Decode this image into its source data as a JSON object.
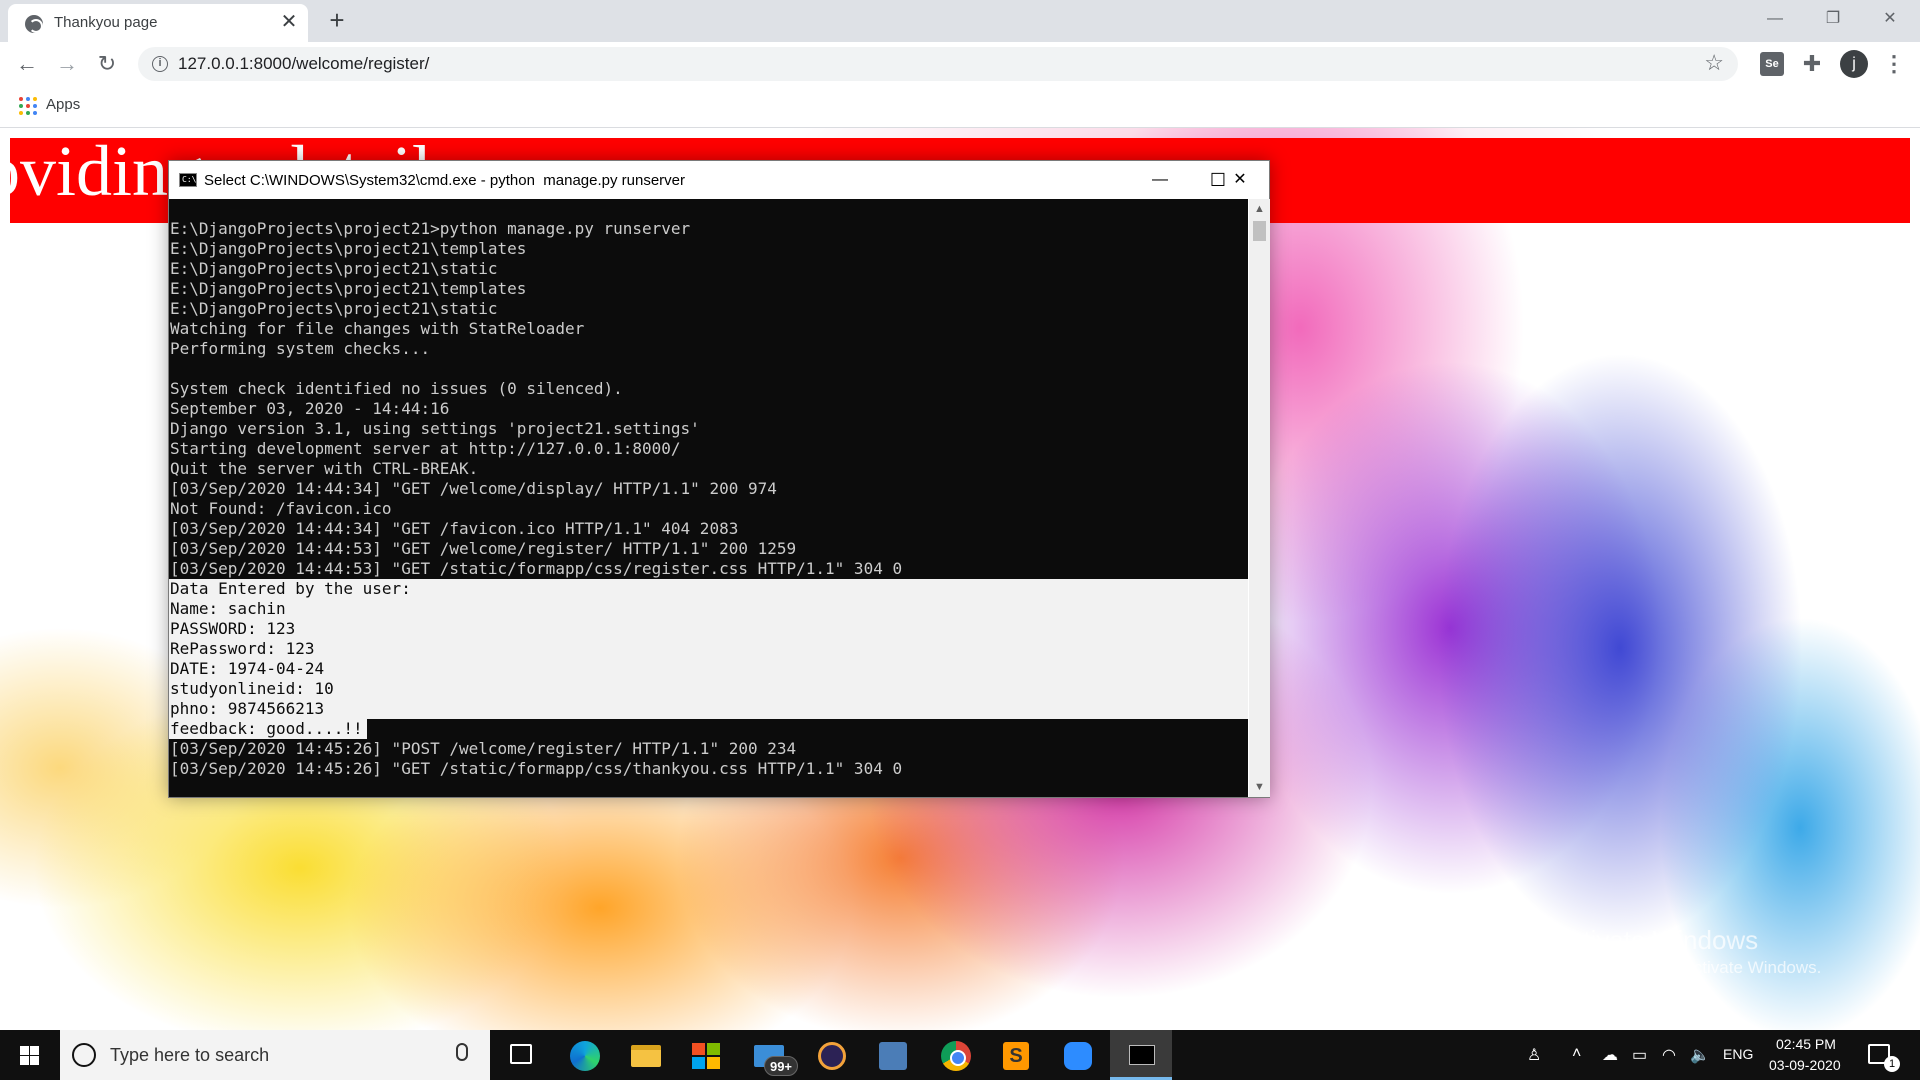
{
  "browser": {
    "tab_title": "Thankyou page",
    "tab_close": "✕",
    "new_tab": "+",
    "url": "127.0.0.1:8000/welcome/register/",
    "bookmarks_label": "Apps",
    "profile_initial": "j",
    "extension_label": "Se"
  },
  "page": {
    "header_text": "oviding e details",
    "header_color": "#ff0000",
    "watermark_title": "Activate Windows",
    "watermark_subtitle": "Go to Settings to activate Windows."
  },
  "cmd": {
    "title": "Select C:\\WINDOWS\\System32\\cmd.exe - python  manage.py runserver",
    "lines_normal": [
      "E:\\DjangoProjects\\project21>python manage.py runserver",
      "E:\\DjangoProjects\\project21\\templates",
      "E:\\DjangoProjects\\project21\\static",
      "E:\\DjangoProjects\\project21\\templates",
      "E:\\DjangoProjects\\project21\\static",
      "Watching for file changes with StatReloader",
      "Performing system checks...",
      "",
      "System check identified no issues (0 silenced).",
      "September 03, 2020 - 14:44:16",
      "Django version 3.1, using settings 'project21.settings'",
      "Starting development server at http://127.0.0.1:8000/",
      "Quit the server with CTRL-BREAK.",
      "[03/Sep/2020 14:44:34] \"GET /welcome/display/ HTTP/1.1\" 200 974",
      "Not Found: /favicon.ico",
      "[03/Sep/2020 14:44:34] \"GET /favicon.ico HTTP/1.1\" 404 2083",
      "[03/Sep/2020 14:44:53] \"GET /welcome/register/ HTTP/1.1\" 200 1259",
      "[03/Sep/2020 14:44:53] \"GET /static/formapp/css/register.css HTTP/1.1\" 304 0"
    ],
    "lines_selected": [
      "Data Entered by the user:",
      "Name: sachin",
      "PASSWORD: 123",
      "RePassword: 123",
      "DATE: 1974-04-24",
      "studyonlineid: 10",
      "phno: 9874566213",
      "feedback: good....!!"
    ],
    "lines_after": [
      "[03/Sep/2020 14:45:26] \"POST /welcome/register/ HTTP/1.1\" 200 234",
      "[03/Sep/2020 14:45:26] \"GET /static/formapp/css/thankyou.css HTTP/1.1\" 304 0"
    ]
  },
  "taskbar": {
    "search_placeholder": "Type here to search",
    "mail_badge": "99+",
    "language": "ENG",
    "time": "02:45 PM",
    "date": "03-09-2020",
    "notification_count": "1",
    "pinned_apps": [
      "task-view-icon",
      "edge-icon",
      "file-explorer-icon",
      "store-icon",
      "mail-icon",
      "eclipse-icon",
      "vmware-icon",
      "chrome-icon",
      "sublime-icon",
      "zoom-icon",
      "cmd-icon"
    ]
  },
  "colors": {
    "accent_blue": "#76b9ed",
    "cmd_background": "#0c0c0c",
    "cmd_text": "#cccccc"
  }
}
